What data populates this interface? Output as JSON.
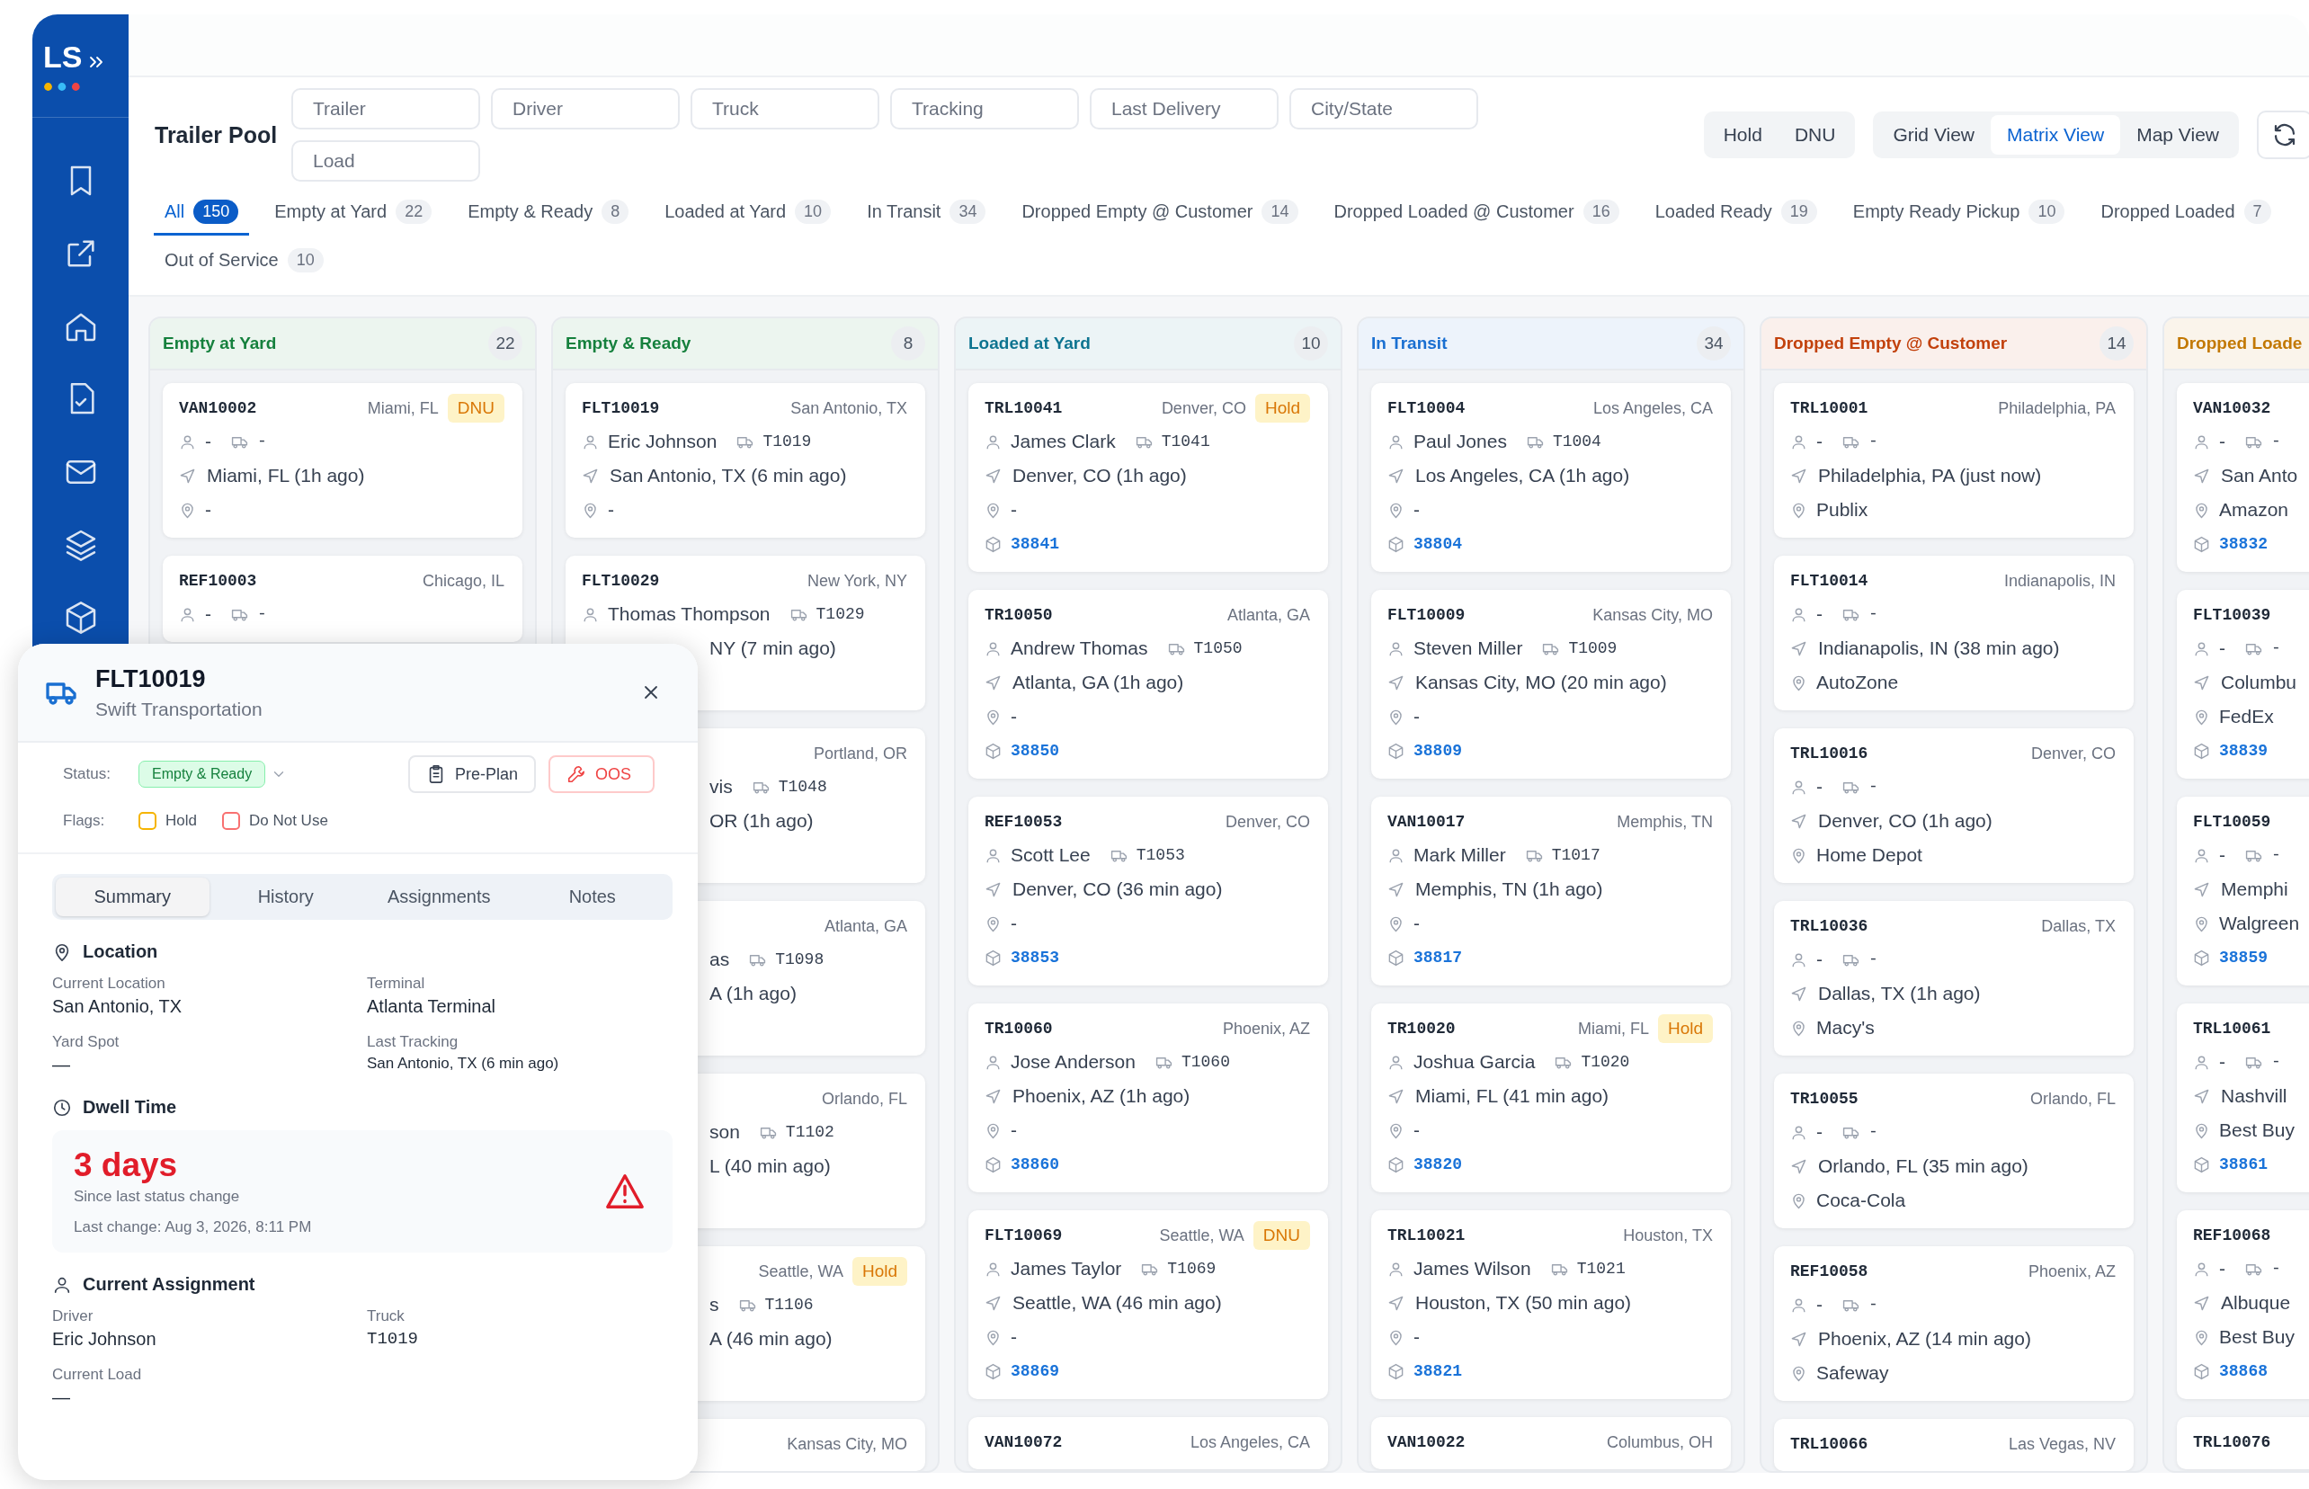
{
  "app": {
    "logo": "LS"
  },
  "page": {
    "title": "Trailer Pool"
  },
  "filters": [
    {
      "placeholder": "Trailer"
    },
    {
      "placeholder": "Driver"
    },
    {
      "placeholder": "Truck"
    },
    {
      "placeholder": "Tracking"
    },
    {
      "placeholder": "Last Delivery"
    },
    {
      "placeholder": "City/State"
    },
    {
      "placeholder": "Load"
    }
  ],
  "flag_toggles": [
    "Hold",
    "DNU"
  ],
  "views": [
    {
      "label": "Grid View",
      "selected": false
    },
    {
      "label": "Matrix View",
      "selected": true
    },
    {
      "label": "Map View",
      "selected": false
    }
  ],
  "tabs": [
    {
      "label": "All",
      "count": "150",
      "selected": true
    },
    {
      "label": "Empty at Yard",
      "count": "22",
      "selected": false
    },
    {
      "label": "Empty & Ready",
      "count": "8",
      "selected": false
    },
    {
      "label": "Loaded at Yard",
      "count": "10",
      "selected": false
    },
    {
      "label": "In Transit",
      "count": "34",
      "selected": false
    },
    {
      "label": "Dropped Empty @ Customer",
      "count": "14",
      "selected": false
    },
    {
      "label": "Dropped Loaded @ Customer",
      "count": "16",
      "selected": false
    },
    {
      "label": "Loaded Ready",
      "count": "19",
      "selected": false
    },
    {
      "label": "Empty Ready Pickup",
      "count": "10",
      "selected": false
    },
    {
      "label": "Dropped Loaded",
      "count": "7",
      "selected": false
    },
    {
      "label": "Out of Service",
      "count": "10",
      "selected": false
    }
  ],
  "columns": [
    {
      "title": "Empty at Yard",
      "count": "22",
      "color": "#15803d",
      "cards": [
        {
          "kind": "full",
          "id": "VAN10002",
          "city": "Miami, FL",
          "badge": "DNU",
          "driver": "-",
          "truck": "-",
          "track": "Miami, FL (1h ago)",
          "place": "-"
        },
        {
          "kind": "full",
          "id": "REF10003",
          "city": "Chicago, IL",
          "driver": "-",
          "truck": "-"
        }
      ]
    },
    {
      "title": "Empty & Ready",
      "count": "8",
      "color": "#15803d",
      "cards": [
        {
          "kind": "full",
          "id": "FLT10019",
          "city": "San Antonio, TX",
          "driver": "Eric Johnson",
          "truck": "T1019",
          "track": "San Antonio, TX (6 min ago)",
          "place": "-"
        },
        {
          "kind": "lower_clipped",
          "id": "FLT10029",
          "city": "New York, NY",
          "driver": "Thomas Thompson",
          "truck": "T1029",
          "track": "NY (7 min ago)"
        },
        {
          "kind": "clipped",
          "city": "Portland, OR",
          "driver": "vis",
          "truck": "T1048",
          "track": "OR (1h ago)"
        },
        {
          "kind": "clipped",
          "city": "Atlanta, GA",
          "driver": "as",
          "truck": "T1098",
          "track": "A (1h ago)"
        },
        {
          "kind": "clipped",
          "city": "Orlando, FL",
          "driver": "son",
          "truck": "T1102",
          "track": "L (40 min ago)"
        },
        {
          "kind": "clipped",
          "city": "Seattle, WA",
          "badge": "Hold",
          "driver": "s",
          "truck": "T1106",
          "track": "A (46 min ago)"
        },
        {
          "kind": "clipped",
          "city": "Kansas City, MO"
        }
      ]
    },
    {
      "title": "Loaded at Yard",
      "count": "10",
      "color": "#0e7490",
      "cards": [
        {
          "kind": "full",
          "id": "TRL10041",
          "city": "Denver, CO",
          "badge": "Hold",
          "driver": "James Clark",
          "truck": "T1041",
          "track": "Denver, CO (1h ago)",
          "place": "-",
          "load": "38841"
        },
        {
          "kind": "full",
          "id": "TR10050",
          "city": "Atlanta, GA",
          "driver": "Andrew Thomas",
          "truck": "T1050",
          "track": "Atlanta, GA (1h ago)",
          "place": "-",
          "load": "38850"
        },
        {
          "kind": "full",
          "id": "REF10053",
          "city": "Denver, CO",
          "driver": "Scott Lee",
          "truck": "T1053",
          "track": "Denver, CO (36 min ago)",
          "place": "-",
          "load": "38853"
        },
        {
          "kind": "full",
          "id": "TR10060",
          "city": "Phoenix, AZ",
          "driver": "Jose Anderson",
          "truck": "T1060",
          "track": "Phoenix, AZ (1h ago)",
          "place": "-",
          "load": "38860"
        },
        {
          "kind": "full",
          "id": "FLT10069",
          "city": "Seattle, WA",
          "badge": "DNU",
          "driver": "James Taylor",
          "truck": "T1069",
          "track": "Seattle, WA (46 min ago)",
          "place": "-",
          "load": "38869"
        },
        {
          "kind": "full",
          "id": "VAN10072",
          "city": "Los Angeles, CA"
        }
      ]
    },
    {
      "title": "In Transit",
      "count": "34",
      "color": "#1a6fd1",
      "cards": [
        {
          "kind": "full",
          "id": "FLT10004",
          "city": "Los Angeles, CA",
          "driver": "Paul Jones",
          "truck": "T1004",
          "track": "Los Angeles, CA (1h ago)",
          "place": "-",
          "load": "38804"
        },
        {
          "kind": "full",
          "id": "FLT10009",
          "city": "Kansas City, MO",
          "driver": "Steven Miller",
          "truck": "T1009",
          "track": "Kansas City, MO (20 min ago)",
          "place": "-",
          "load": "38809"
        },
        {
          "kind": "full",
          "id": "VAN10017",
          "city": "Memphis, TN",
          "driver": "Mark Miller",
          "truck": "T1017",
          "track": "Memphis, TN (1h ago)",
          "place": "-",
          "load": "38817"
        },
        {
          "kind": "full",
          "id": "TR10020",
          "city": "Miami, FL",
          "badge": "Hold",
          "driver": "Joshua Garcia",
          "truck": "T1020",
          "track": "Miami, FL (41 min ago)",
          "place": "-",
          "load": "38820"
        },
        {
          "kind": "full",
          "id": "TRL10021",
          "city": "Houston, TX",
          "driver": "James Wilson",
          "truck": "T1021",
          "track": "Houston, TX (50 min ago)",
          "place": "-",
          "load": "38821"
        },
        {
          "kind": "full",
          "id": "VAN10022",
          "city": "Columbus, OH"
        }
      ]
    },
    {
      "title": "Dropped Empty @ Customer",
      "count": "14",
      "color": "#c2410c",
      "cards": [
        {
          "kind": "full",
          "id": "TRL10001",
          "city": "Philadelphia, PA",
          "driver": "-",
          "truck": "-",
          "track": "Philadelphia, PA (just now)",
          "place": "Publix"
        },
        {
          "kind": "full",
          "id": "FLT10014",
          "city": "Indianapolis, IN",
          "driver": "-",
          "truck": "-",
          "track": "Indianapolis, IN (38 min ago)",
          "place": "AutoZone"
        },
        {
          "kind": "full",
          "id": "TRL10016",
          "city": "Denver, CO",
          "driver": "-",
          "truck": "-",
          "track": "Denver, CO (1h ago)",
          "place": "Home Depot"
        },
        {
          "kind": "full",
          "id": "TRL10036",
          "city": "Dallas, TX",
          "driver": "-",
          "truck": "-",
          "track": "Dallas, TX (1h ago)",
          "place": "Macy's"
        },
        {
          "kind": "full",
          "id": "TR10055",
          "city": "Orlando, FL",
          "driver": "-",
          "truck": "-",
          "track": "Orlando, FL (35 min ago)",
          "place": "Coca-Cola"
        },
        {
          "kind": "full",
          "id": "REF10058",
          "city": "Phoenix, AZ",
          "driver": "-",
          "truck": "-",
          "track": "Phoenix, AZ (14 min ago)",
          "place": "Safeway"
        },
        {
          "kind": "full",
          "id": "TRL10066",
          "city": "Las Vegas, NV"
        }
      ]
    },
    {
      "title": "Dropped Loade",
      "color": "#c27803",
      "cards": [
        {
          "kind": "full",
          "id": "VAN10032",
          "driver": "-",
          "truck": "-",
          "track": "San Anto",
          "place": "Amazon",
          "load": "38832"
        },
        {
          "kind": "full",
          "id": "FLT10039",
          "driver": "-",
          "truck": "-",
          "track": "Columbu",
          "place": "FedEx",
          "load": "38839"
        },
        {
          "kind": "full",
          "id": "FLT10059",
          "driver": "-",
          "truck": "-",
          "track": "Memphi",
          "place": "Walgreen",
          "load": "38859"
        },
        {
          "kind": "full",
          "id": "TRL10061",
          "driver": "-",
          "truck": "-",
          "track": "Nashvill",
          "place": "Best Buy",
          "load": "38861"
        },
        {
          "kind": "full",
          "id": "REF10068",
          "driver": "-",
          "truck": "-",
          "track": "Albuque",
          "place": "Best Buy",
          "load": "38868"
        },
        {
          "kind": "full",
          "id": "TRL10076"
        }
      ]
    }
  ],
  "detail": {
    "id": "FLT10019",
    "carrier": "Swift Transportation",
    "status_label": "Status:",
    "status": "Empty & Ready",
    "actions": [
      {
        "kind": "plan",
        "label": "Pre-Plan"
      },
      {
        "kind": "oos",
        "label": "OOS"
      }
    ],
    "flags_label": "Flags:",
    "flags": [
      {
        "label": "Hold",
        "checked": false,
        "color": "#f5b400"
      },
      {
        "label": "Do Not Use",
        "checked": false,
        "color": "#f87171"
      }
    ],
    "tabs": [
      {
        "label": "Summary",
        "selected": true
      },
      {
        "label": "History",
        "selected": false
      },
      {
        "label": "Assignments",
        "selected": false
      },
      {
        "label": "Notes",
        "selected": false
      }
    ],
    "location": {
      "title": "Location",
      "fields": [
        {
          "label": "Current Location",
          "value": "San Antonio, TX",
          "kind": "large"
        },
        {
          "label": "Terminal",
          "value": "Atlanta Terminal",
          "kind": "large"
        },
        {
          "label": "Yard Spot",
          "value": "—",
          "kind": "large"
        },
        {
          "label": "Last Tracking",
          "value": "San Antonio, TX (6 min ago)",
          "kind": "small"
        }
      ]
    },
    "dwell": {
      "title": "Dwell Time",
      "value": "3 days",
      "caption": "Since last status change",
      "last_change": "Last change: Aug 3, 2026, 8:11 PM",
      "warning": true
    },
    "assignment": {
      "title": "Current Assignment",
      "fields": [
        {
          "label": "Driver",
          "value": "Eric Johnson",
          "kind": "large"
        },
        {
          "label": "Truck",
          "value": "T1019",
          "kind": "code"
        },
        {
          "label": "Current Load",
          "value": "—",
          "kind": "large"
        }
      ]
    }
  }
}
